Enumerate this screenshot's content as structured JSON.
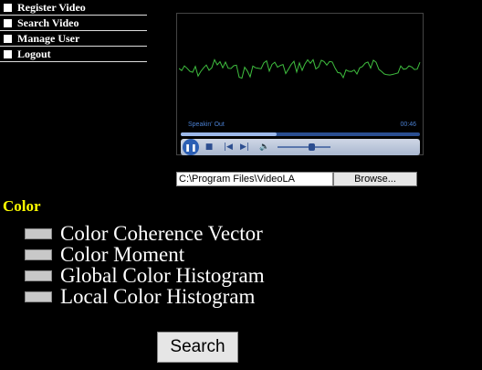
{
  "nav": {
    "items": [
      {
        "label": "Register Video"
      },
      {
        "label": "Search Video"
      },
      {
        "label": "Manage User"
      },
      {
        "label": "Logout"
      }
    ]
  },
  "player": {
    "track_title": "Speakin' Out",
    "time": "00:46",
    "progress_fraction": 0.4,
    "volume_fraction": 0.6
  },
  "file": {
    "value": "C:\\Program Files\\VideoLA",
    "browse_label": "Browse..."
  },
  "features": {
    "heading": "Color",
    "options": [
      {
        "label": "Color Coherence Vector",
        "checked": false
      },
      {
        "label": "Color Moment",
        "checked": false
      },
      {
        "label": "Global Color Histogram",
        "checked": false
      },
      {
        "label": "Local Color Histogram",
        "checked": false
      }
    ]
  },
  "search": {
    "label": "Search"
  },
  "colors": {
    "accent_heading": "#ffff00",
    "waveform": "#3fbf3f",
    "player_blue": "#2c5fb4"
  }
}
